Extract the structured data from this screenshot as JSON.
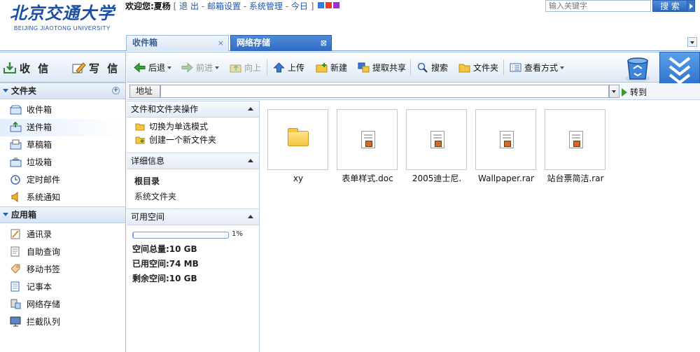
{
  "header": {
    "logo_cn": "北京交通大学",
    "logo_en": "BEIJING JIAOTONG UNIVERSITY",
    "welcome": "欢迎您:夏杨",
    "links": [
      "退 出",
      "邮箱设置",
      "系统管理",
      "今日"
    ],
    "search_placeholder": "输入关键字",
    "search_button": "搜 索",
    "square_colors": [
      "#2f7fe0",
      "#f03a2a",
      "#9b33c9"
    ]
  },
  "tabs": [
    {
      "label": "收件箱",
      "close": "×"
    },
    {
      "label": "网络存储",
      "close": "⊠"
    }
  ],
  "sidebar": {
    "receive_label": "收 信",
    "write_label": "写 信",
    "folders_title": "文件夹",
    "folders_add": "+",
    "folders": [
      {
        "label": "收件箱",
        "icon": "inbox-icon"
      },
      {
        "label": "送件箱",
        "icon": "outbox-icon"
      },
      {
        "label": "草稿箱",
        "icon": "drafts-icon"
      },
      {
        "label": "垃圾箱",
        "icon": "trash-icon"
      },
      {
        "label": "定时邮件",
        "icon": "clock-icon"
      },
      {
        "label": "系统通知",
        "icon": "speaker-icon"
      }
    ],
    "apps_title": "应用箱",
    "apps": [
      {
        "label": "通讯录",
        "icon": "address-book-icon"
      },
      {
        "label": "自助查询",
        "icon": "query-icon"
      },
      {
        "label": "移动书签",
        "icon": "bookmark-icon"
      },
      {
        "label": "记事本",
        "icon": "notepad-icon"
      },
      {
        "label": "网络存储",
        "icon": "network-storage-icon"
      },
      {
        "label": "拦截队列",
        "icon": "monitor-icon"
      }
    ]
  },
  "toolbar": {
    "back": "后退",
    "forward": "前进",
    "up": "向上",
    "upload": "上传",
    "new": "新建",
    "fetch_share": "提取共享",
    "search": "搜索",
    "folder": "文件夹",
    "view_mode": "查看方式"
  },
  "addressbar": {
    "label": "地址",
    "value": "",
    "go": "转到"
  },
  "infopane": {
    "ops_title": "文件和文件夹操作",
    "ops": [
      "切换为单选模式",
      "创建一个新文件夹"
    ],
    "detail_title": "详细信息",
    "detail_name": "根目录",
    "detail_type": "系统文件夹",
    "space_title": "可用空间",
    "space_percent": 1,
    "space_percent_label": "1%",
    "space_total": "空间总量:10 GB",
    "space_used": "已用空间:74 MB",
    "space_free": "剩余空间:10 GB"
  },
  "files": [
    {
      "name": "xy",
      "kind": "folder"
    },
    {
      "name": "表单样式.doc",
      "kind": "file"
    },
    {
      "name": "2005迪士尼.",
      "kind": "file"
    },
    {
      "name": "Wallpaper.rar",
      "kind": "file"
    },
    {
      "name": "站台票简洁.rar",
      "kind": "file"
    }
  ]
}
